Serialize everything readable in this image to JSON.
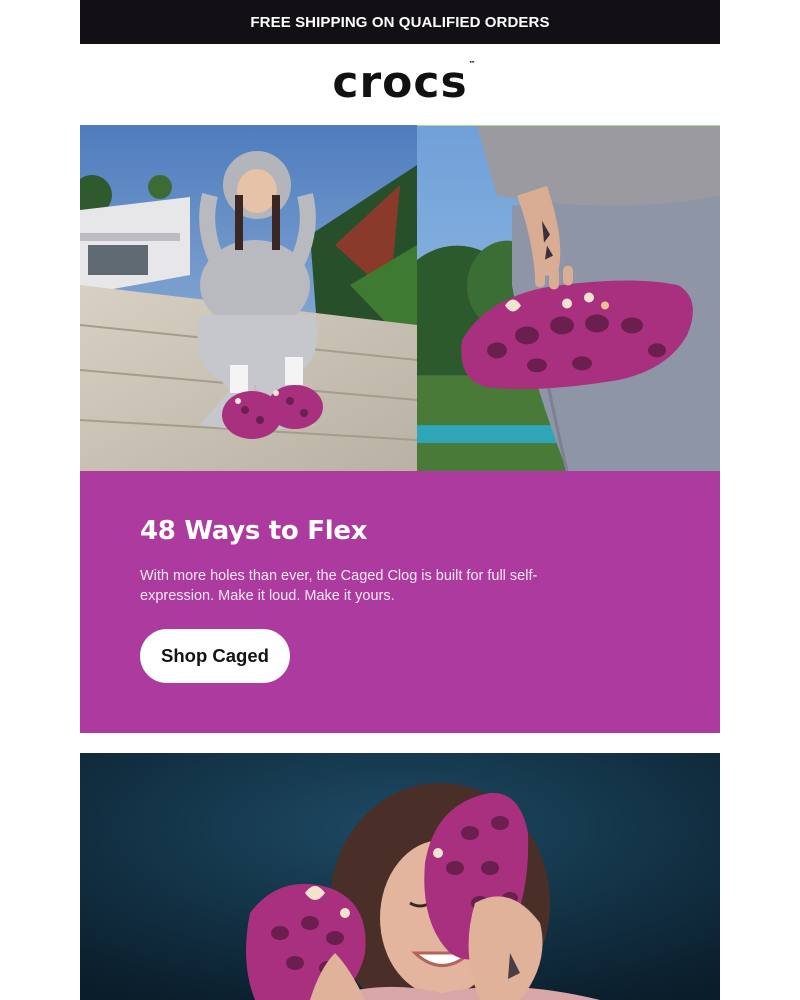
{
  "banner": {
    "text": "FREE SHIPPING ON QUALIFIED ORDERS"
  },
  "logo": {
    "text": "crocs",
    "trademark": "™"
  },
  "hero": {
    "left_image": "woman-in-grey-hoodie-sitting-on-steps",
    "right_image": "hand-holding-purple-caged-clog"
  },
  "promo": {
    "title": "48 Ways to Flex",
    "body": "With more holes than ever, the Caged Clog is built for full self-expression. Make it loud. Make it yours.",
    "button_label": "Shop Caged",
    "background_color": "#ad3a9e"
  },
  "feature": {
    "image": "woman-holding-purple-clogs-to-face"
  },
  "colors": {
    "banner": "#121015",
    "clog_purple": "#a8307e",
    "text_dark": "#141414"
  }
}
